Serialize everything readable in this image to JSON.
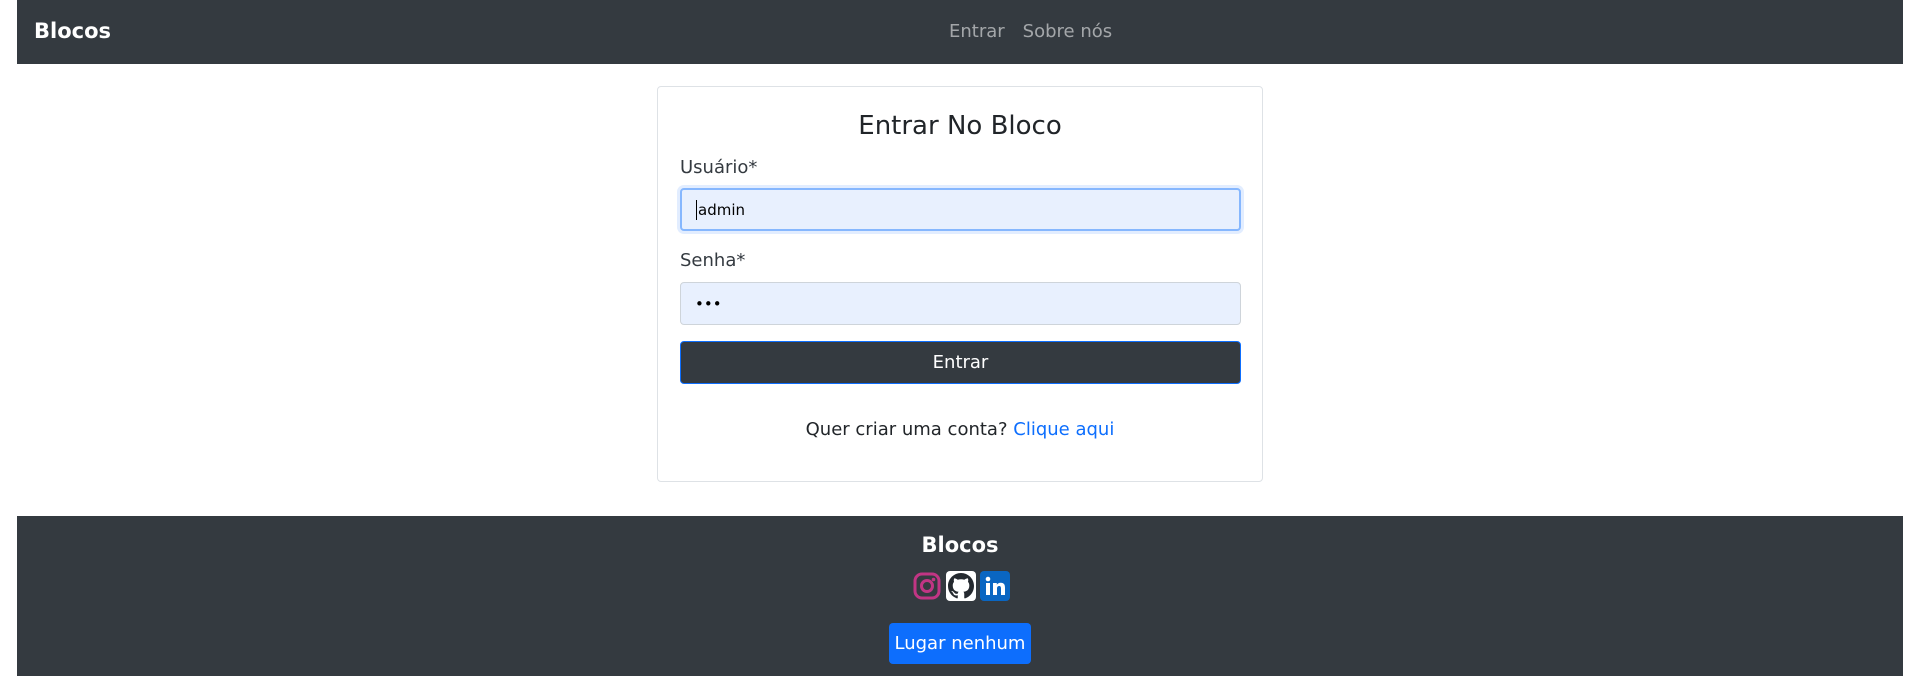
{
  "navbar": {
    "brand": "Blocos",
    "links": [
      "Entrar",
      "Sobre nós"
    ]
  },
  "login": {
    "title": "Entrar No Bloco",
    "username_label": "Usuário*",
    "username_value": "admin",
    "password_label": "Senha*",
    "password_value": "•••",
    "submit_label": "Entrar",
    "signup_prompt": "Quer criar uma conta?",
    "signup_link": "Clique aqui"
  },
  "footer": {
    "title": "Blocos",
    "socials": [
      "instagram-icon",
      "github-icon",
      "linkedin-icon"
    ],
    "button_label": "Lugar nenhum"
  },
  "colors": {
    "dark": "#343a40",
    "primary": "#0d6efd",
    "instagram": "#c13584",
    "input_bg": "#e8f0fe"
  }
}
